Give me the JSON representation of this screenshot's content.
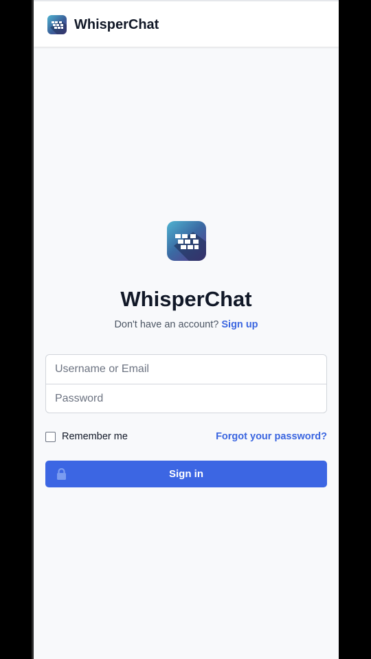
{
  "header": {
    "app_name": "WhisperChat"
  },
  "login": {
    "title": "WhisperChat",
    "no_account_text": "Don't have an account?",
    "signup_link": "Sign up",
    "username_placeholder": "Username or Email",
    "password_placeholder": "Password",
    "remember_label": "Remember me",
    "remember_checked": false,
    "forgot_link": "Forgot your password?",
    "signin_label": "Sign in"
  },
  "icons": {
    "logo": "whisperchat-logo-icon",
    "lock": "lock-icon",
    "checkbox": "checkbox"
  },
  "colors": {
    "accent": "#3c66e3",
    "link": "#3b66e0",
    "page_background": "#f8f9fb",
    "logo_gradient_top": "#4fb3d1",
    "logo_gradient_bottom": "#5b3d8f"
  }
}
